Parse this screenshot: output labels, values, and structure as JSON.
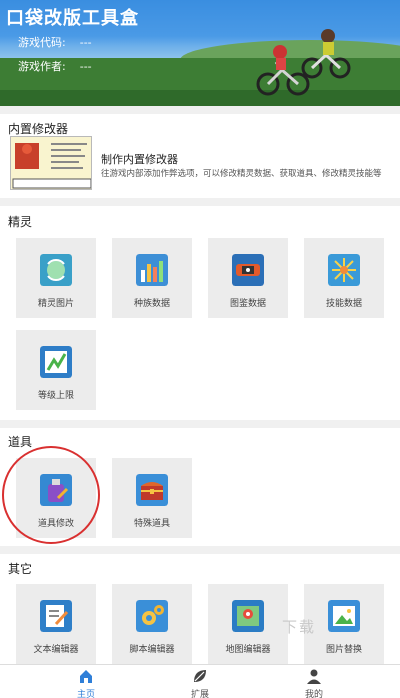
{
  "app_title": "口袋改版工具盒",
  "header": {
    "game_code_label": "游戏代码:",
    "game_code_value": "---",
    "game_author_label": "游戏作者:",
    "game_author_value": "---"
  },
  "builtin": {
    "section_title": "内置修改器",
    "item_title": "制作内置修改器",
    "item_desc": "往游戏内部添加作弊选项，可以修改精灵数据、获取道具、修改精灵技能等"
  },
  "sprites": {
    "section_title": "精灵",
    "tiles": [
      {
        "label": "精灵图片",
        "icon": "sprite-image-icon"
      },
      {
        "label": "种族数据",
        "icon": "bar-chart-icon"
      },
      {
        "label": "图鉴数据",
        "icon": "pokedex-icon"
      },
      {
        "label": "技能数据",
        "icon": "burst-icon"
      },
      {
        "label": "等级上限",
        "icon": "level-up-icon"
      }
    ]
  },
  "items": {
    "section_title": "道具",
    "tiles": [
      {
        "label": "道具修改",
        "icon": "potion-edit-icon"
      },
      {
        "label": "特殊道具",
        "icon": "treasure-chest-icon"
      }
    ]
  },
  "other": {
    "section_title": "其它",
    "tiles": [
      {
        "label": "文本编辑器",
        "icon": "text-edit-icon"
      },
      {
        "label": "脚本编辑器",
        "icon": "gear-script-icon"
      },
      {
        "label": "地图编辑器",
        "icon": "map-edit-icon"
      },
      {
        "label": "图片替换",
        "icon": "image-replace-icon"
      }
    ]
  },
  "watermark": "下载",
  "bottom_nav": [
    {
      "label": "主页",
      "icon": "home-icon",
      "active": true
    },
    {
      "label": "扩展",
      "icon": "leaf-icon",
      "active": false
    },
    {
      "label": "我的",
      "icon": "user-icon",
      "active": false
    }
  ],
  "colors": {
    "accent": "#2f7fd8",
    "annotation": "#d93030"
  }
}
